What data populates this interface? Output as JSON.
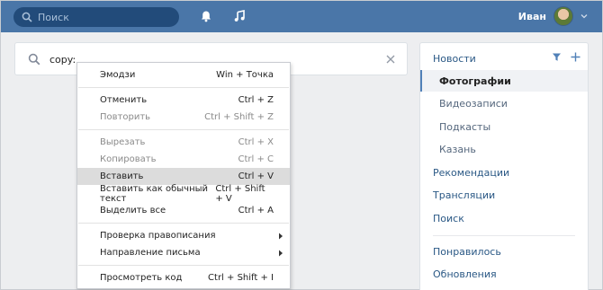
{
  "header": {
    "search_placeholder": "Поиск",
    "user_name": "Иван"
  },
  "main": {
    "query": "copy:"
  },
  "context_menu": {
    "items": [
      {
        "label": "Эмодзи",
        "shortcut": "Win + Точка",
        "state": "enabled"
      },
      {
        "label": "Отменить",
        "shortcut": "Ctrl + Z",
        "state": "enabled"
      },
      {
        "label": "Повторить",
        "shortcut": "Ctrl + Shift + Z",
        "state": "disabled"
      },
      {
        "label": "Вырезать",
        "shortcut": "Ctrl + X",
        "state": "disabled"
      },
      {
        "label": "Копировать",
        "shortcut": "Ctrl + C",
        "state": "disabled"
      },
      {
        "label": "Вставить",
        "shortcut": "Ctrl + V",
        "state": "highlighted"
      },
      {
        "label": "Вставить как обычный текст",
        "shortcut": "Ctrl + Shift + V",
        "state": "enabled"
      },
      {
        "label": "Выделить все",
        "shortcut": "Ctrl + A",
        "state": "enabled"
      },
      {
        "label": "Проверка правописания",
        "shortcut": "",
        "state": "submenu"
      },
      {
        "label": "Направление письма",
        "shortcut": "",
        "state": "submenu"
      },
      {
        "label": "Просмотреть код",
        "shortcut": "Ctrl + Shift + I",
        "state": "enabled"
      }
    ]
  },
  "sidebar": {
    "items": [
      {
        "label": "Новости",
        "kind": "top"
      },
      {
        "label": "Фотографии",
        "kind": "active"
      },
      {
        "label": "Видеозаписи",
        "kind": "sub"
      },
      {
        "label": "Подкасты",
        "kind": "sub"
      },
      {
        "label": "Казань",
        "kind": "sub"
      },
      {
        "label": "Рекомендации",
        "kind": "top"
      },
      {
        "label": "Трансляции",
        "kind": "top"
      },
      {
        "label": "Поиск",
        "kind": "top"
      },
      {
        "label": "Понравилось",
        "kind": "top"
      },
      {
        "label": "Обновления",
        "kind": "top"
      }
    ]
  },
  "colors": {
    "header_bg": "#4a76a8",
    "page_bg": "#edeef0",
    "link": "#2a5885",
    "active_marker": "#5181b8"
  },
  "icons": [
    "search-icon",
    "bell-icon",
    "music-icon",
    "chevron-down-icon",
    "clear-icon",
    "filter-icon",
    "plus-icon",
    "submenu-arrow-icon"
  ]
}
